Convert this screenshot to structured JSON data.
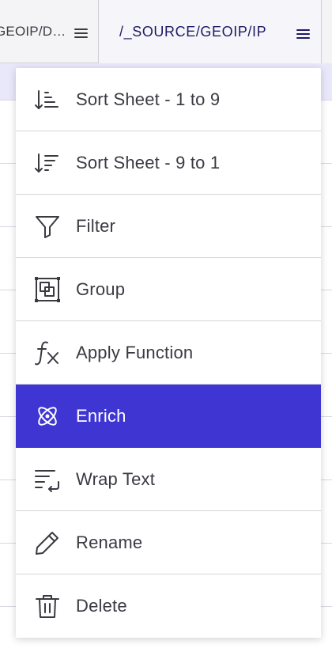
{
  "columns": {
    "left_header_label": "GEOIP/D…",
    "active_header_label": "/_SOURCE/GEOIP/IP"
  },
  "colors": {
    "accent": "#3f35d3",
    "header_text": "#1e1a66",
    "selected_band": "#e9e8fb"
  },
  "menu": {
    "items": [
      {
        "label": "Sort Sheet - 1 to 9",
        "icon": "sort-ascending-icon"
      },
      {
        "label": "Sort Sheet - 9 to 1",
        "icon": "sort-descending-icon"
      },
      {
        "label": "Filter",
        "icon": "funnel-icon"
      },
      {
        "label": "Group",
        "icon": "group-icon"
      },
      {
        "label": "Apply Function",
        "icon": "function-icon"
      },
      {
        "label": "Enrich",
        "icon": "atom-icon",
        "highlighted": true
      },
      {
        "label": "Wrap Text",
        "icon": "wrap-text-icon"
      },
      {
        "label": "Rename",
        "icon": "pencil-icon"
      },
      {
        "label": "Delete",
        "icon": "trash-icon"
      }
    ]
  }
}
